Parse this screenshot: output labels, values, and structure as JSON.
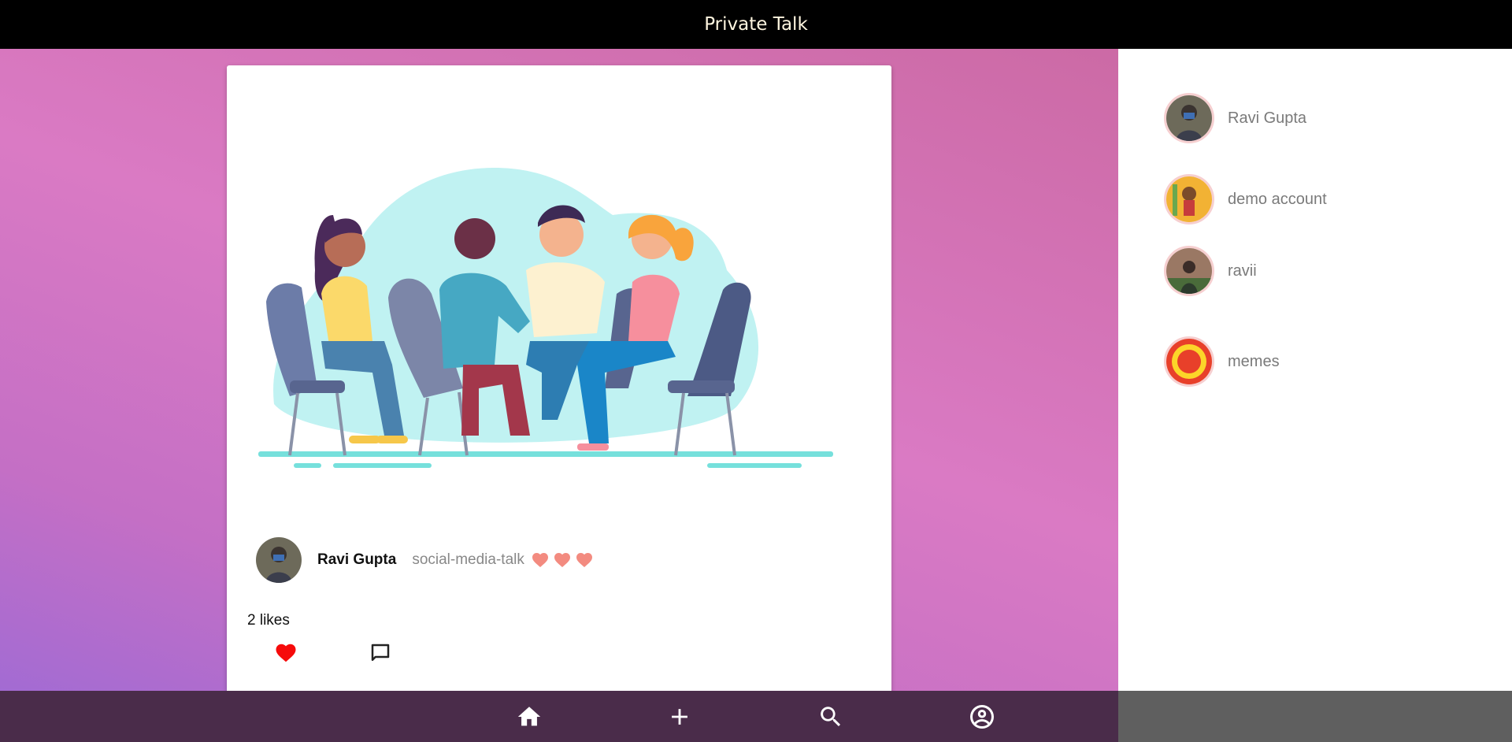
{
  "header": {
    "title": "Private Talk"
  },
  "post": {
    "image_alt": "group-of-people-talking",
    "author": "Ravi Gupta",
    "caption": "social-media-talk",
    "reactions": [
      "heart-icon",
      "heart-icon",
      "heart-icon"
    ],
    "likes_text": "2 likes",
    "liked": true
  },
  "sidebar": {
    "users": [
      {
        "name": "Ravi Gupta"
      },
      {
        "name": "demo account"
      },
      {
        "name": "ravii"
      },
      {
        "name": "memes"
      }
    ]
  },
  "bottom_nav": {
    "items": [
      "home-icon",
      "add-icon",
      "search-icon",
      "account-icon"
    ]
  },
  "colors": {
    "topbar": "#000000",
    "bottombar": "#4a2c4a",
    "heart": "#f60b0b",
    "caption_heart": "#f38b80"
  }
}
